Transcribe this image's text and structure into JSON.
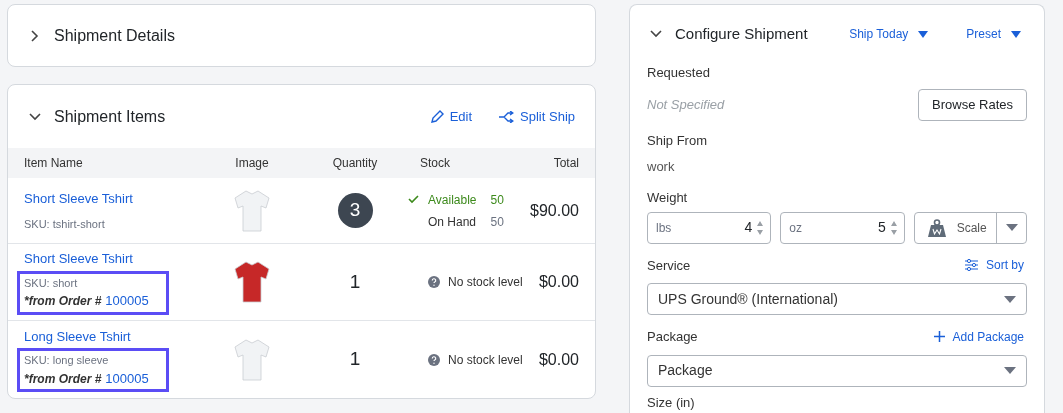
{
  "shipment_details": {
    "title": "Shipment Details",
    "expanded": false
  },
  "shipment_items": {
    "title": "Shipment Items",
    "expanded": true,
    "actions": [
      "Edit",
      "Split Ship"
    ],
    "columns": [
      "Item Name",
      "Image",
      "Quantity",
      "Stock",
      "Total"
    ],
    "rows": [
      {
        "name": "Short Sleeve Tshirt",
        "sku": "SKU: tshirt-short",
        "from_order": null,
        "order_number": null,
        "highlighted": false,
        "color": "#f1f3f5",
        "quantity": "3",
        "quantity_badge": true,
        "stock": {
          "kind": "levels",
          "available_label": "Available",
          "available": "50",
          "on_hand_label": "On Hand",
          "on_hand": "50"
        },
        "total": "$90.00"
      },
      {
        "name": "Short Sleeve Tshirt",
        "sku": "SKU: short",
        "from_order": "*from Order #",
        "order_number": "100005",
        "highlighted": true,
        "color": "#c62828",
        "quantity": "1",
        "quantity_badge": false,
        "stock": {
          "kind": "none",
          "text": "No stock level"
        },
        "total": "$0.00"
      },
      {
        "name": "Long Sleeve Tshirt",
        "sku": "SKU: long sleeve",
        "from_order": "*from Order #",
        "order_number": "100005",
        "highlighted": true,
        "color": "#f1f3f5",
        "quantity": "1",
        "quantity_badge": false,
        "stock": {
          "kind": "none",
          "text": "No stock level"
        },
        "total": "$0.00"
      }
    ]
  },
  "configure": {
    "title": "Configure Shipment",
    "expanded": true,
    "menus": [
      "Ship Today",
      "Preset"
    ],
    "requested_label": "Requested",
    "requested_value": "Not Specified",
    "browse_button": "Browse Rates",
    "ship_from_label": "Ship From",
    "ship_from_value": "work",
    "weight_label": "Weight",
    "lbs_placeholder": "lbs",
    "lbs_value": "4",
    "oz_placeholder": "oz",
    "oz_value": "5",
    "scale_button": "Scale",
    "service_label": "Service",
    "sort_by": "Sort by",
    "service_value": "UPS Ground® (International)",
    "package_label": "Package",
    "add_package": "Add Package",
    "package_value": "Package",
    "size_label": "Size (in)"
  }
}
